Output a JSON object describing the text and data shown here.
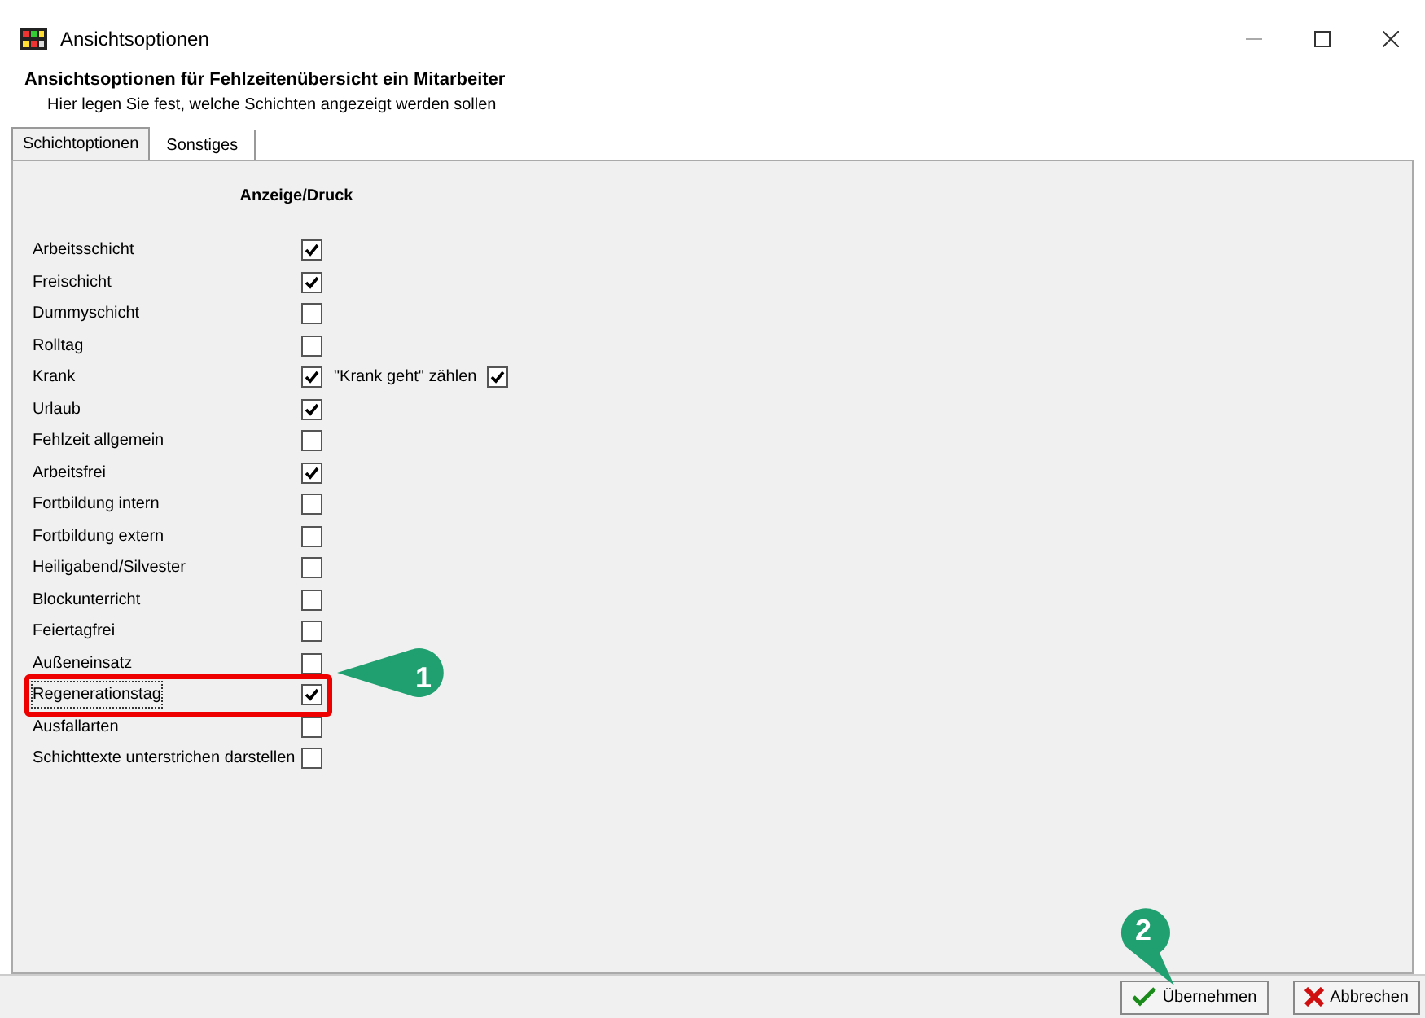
{
  "window": {
    "title": "Ansichtsoptionen"
  },
  "header": {
    "title": "Ansichtsoptionen für Fehlzeitenübersicht ein Mitarbeiter",
    "subtitle": "Hier legen Sie fest, welche Schichten angezeigt werden sollen"
  },
  "tabs": [
    {
      "label": "Schichtoptionen",
      "selected": true
    },
    {
      "label": "Sonstiges",
      "selected": false
    }
  ],
  "column_heading": "Anzeige/Druck",
  "options": [
    {
      "label": "Arbeitsschicht",
      "checked": true
    },
    {
      "label": "Freischicht",
      "checked": true
    },
    {
      "label": "Dummyschicht",
      "checked": false
    },
    {
      "label": "Rolltag",
      "checked": false
    },
    {
      "label": "Krank",
      "checked": true,
      "extra": {
        "label": "\"Krank geht\" zählen",
        "checked": true
      }
    },
    {
      "label": "Urlaub",
      "checked": true
    },
    {
      "label": "Fehlzeit allgemein",
      "checked": false
    },
    {
      "label": "Arbeitsfrei",
      "checked": true
    },
    {
      "label": "Fortbildung intern",
      "checked": false
    },
    {
      "label": "Fortbildung extern",
      "checked": false
    },
    {
      "label": "Heiligabend/Silvester",
      "checked": false
    },
    {
      "label": "Blockunterricht",
      "checked": false
    },
    {
      "label": "Feiertagfrei",
      "checked": false
    },
    {
      "label": "Außeneinsatz",
      "checked": false
    },
    {
      "label": "Regenerationstag",
      "checked": true,
      "focused": true,
      "highlighted": true
    },
    {
      "label": "Ausfallarten",
      "checked": false
    },
    {
      "label": "Schichttexte unterstrichen darstellen",
      "checked": false
    }
  ],
  "callouts": [
    {
      "label": "1"
    },
    {
      "label": "2"
    }
  ],
  "buttons": [
    {
      "label": "Übernehmen",
      "kind": "ok"
    },
    {
      "label": "Abbrechen",
      "kind": "cancel"
    }
  ]
}
